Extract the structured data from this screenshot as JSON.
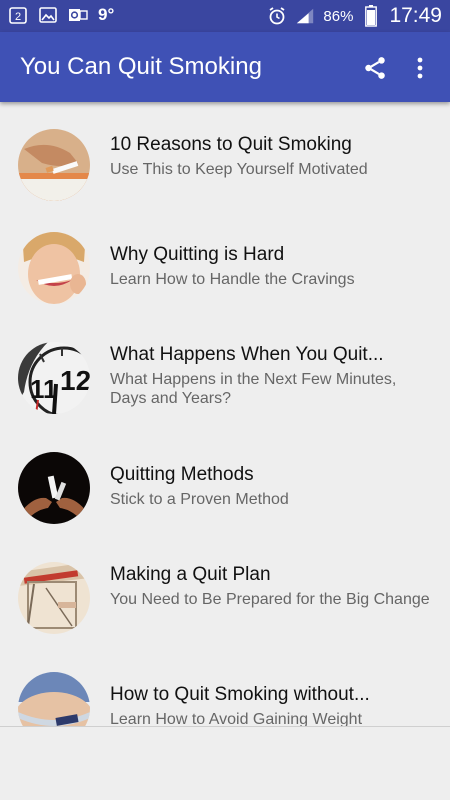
{
  "status_bar": {
    "notification_count": "2",
    "temperature": "9°",
    "battery_percent": "86%",
    "time": "17:49"
  },
  "app_bar": {
    "title": "You Can Quit Smoking",
    "share_icon": "share-icon",
    "menu_icon": "more-vert-icon"
  },
  "items": [
    {
      "title": "10 Reasons to Quit Smoking",
      "subtitle": "Use This to Keep Yourself Motivated",
      "image": "hand-breaking-cigarette-photo"
    },
    {
      "title": "Why Quitting is Hard",
      "subtitle": "Learn How to Handle the Cravings",
      "image": "woman-biting-cigarette-photo"
    },
    {
      "title": "What Happens When You Quit...",
      "subtitle": "What Happens in the Next Few Minutes, Days and Years?",
      "image": "clock-face-photo"
    },
    {
      "title": "Quitting Methods",
      "subtitle": "Stick to a Proven Method",
      "image": "hands-breaking-cigarette-dark-photo"
    },
    {
      "title": "Making a Quit Plan",
      "subtitle": "You Need to Be Prepared for the Big Change",
      "image": "cigarette-in-mousetrap-photo"
    },
    {
      "title": "How to Quit Smoking without...",
      "subtitle": "Learn How to Avoid Gaining Weight",
      "image": "belly-measuring-tape-photo"
    }
  ],
  "colors": {
    "status_bar": "#3a46a0",
    "app_bar": "#3f51b5",
    "background": "#eeeeee"
  }
}
